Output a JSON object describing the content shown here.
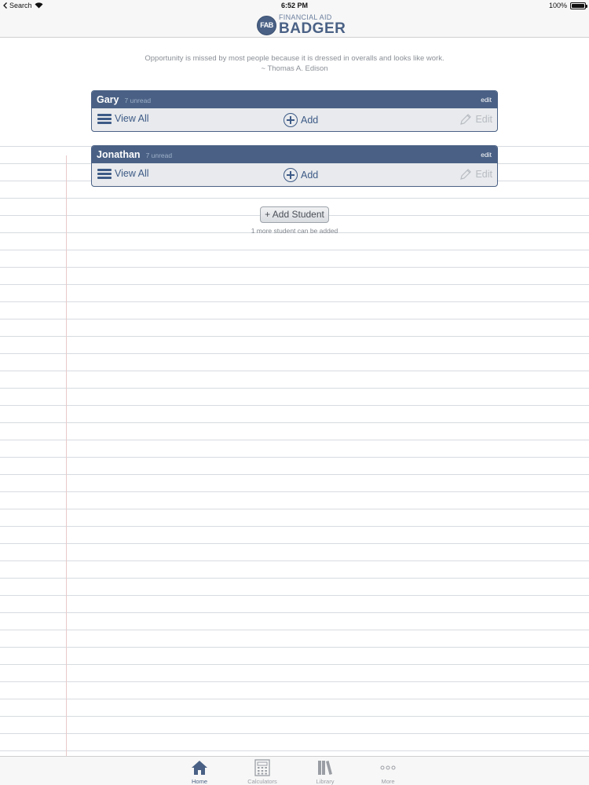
{
  "status_bar": {
    "back_label": "Search",
    "time": "6:52 PM",
    "battery": "100%"
  },
  "header": {
    "logo_monogram": "FAB",
    "logo_line1": "FINANCIAL AID",
    "logo_line2": "BADGER"
  },
  "quote": {
    "text": "Opportunity is missed by most people because it is dressed in overalls and looks like work.",
    "author": "~ Thomas A. Edison"
  },
  "students": [
    {
      "name": "Gary",
      "unread": "7 unread",
      "edit": "edit",
      "view_all": "View All",
      "add": "Add",
      "edit_action": "Edit"
    },
    {
      "name": "Jonathan",
      "unread": "7 unread",
      "edit": "edit",
      "view_all": "View All",
      "add": "Add",
      "edit_action": "Edit"
    }
  ],
  "add_student": {
    "label": "+ Add Student",
    "note": "1 more student can be added"
  },
  "tabs": [
    {
      "label": "Home",
      "icon": "home-icon",
      "active": true
    },
    {
      "label": "Calculators",
      "icon": "calculator-icon",
      "active": false
    },
    {
      "label": "Library",
      "icon": "library-icon",
      "active": false
    },
    {
      "label": "More",
      "icon": "more-icon",
      "active": false
    }
  ],
  "colors": {
    "brand": "#4a6185",
    "action": "#3d5a86",
    "disabled": "#b8bcc2",
    "card_bg": "#e8eaed"
  }
}
